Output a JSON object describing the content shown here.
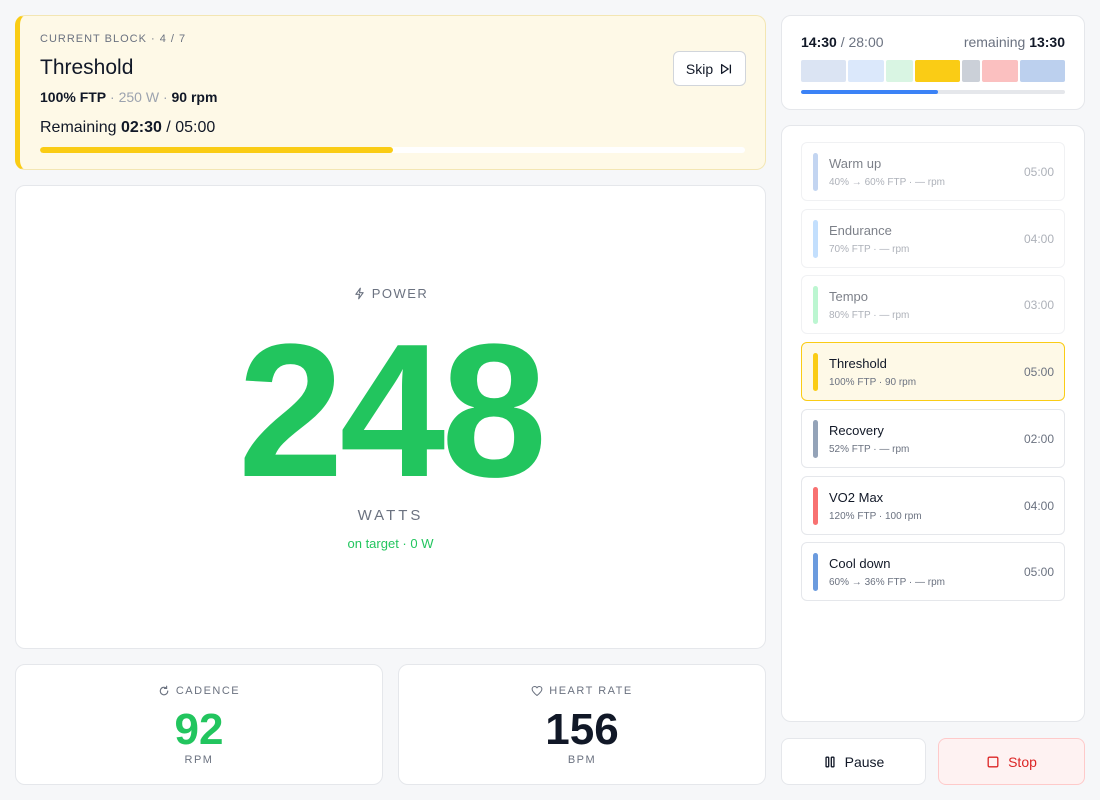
{
  "current_block": {
    "eyebrow": "CURRENT BLOCK · 4 / 7",
    "title": "Threshold",
    "ftp": "100% FTP",
    "watts": "250 W",
    "rpm": "90 rpm",
    "sep": " · ",
    "remaining_label": "Remaining",
    "remaining": "02:30",
    "duration": "05:00",
    "progress": 0.5,
    "skip_label": "Skip",
    "accent_color": "#facc15"
  },
  "power": {
    "label": "POWER",
    "value": "248",
    "unit": "WATTS",
    "target_status": "on target · 0 W",
    "color": "#22c55e"
  },
  "cadence": {
    "label": "CADENCE",
    "value": "92",
    "unit": "RPM",
    "color": "#22c55e"
  },
  "heart_rate": {
    "label": "HEART RATE",
    "value": "156",
    "unit": "BPM",
    "color": "#111827"
  },
  "timeline": {
    "elapsed": "14:30",
    "total": "28:00",
    "remaining_label": "remaining",
    "remaining": "13:30",
    "progress": 0.518,
    "segments": [
      {
        "duration": 5,
        "color": "#dbe4f3"
      },
      {
        "duration": 4,
        "color": "#dbe8fb"
      },
      {
        "duration": 3,
        "color": "#d9f5e3"
      },
      {
        "duration": 5,
        "color": "#facc15"
      },
      {
        "duration": 2,
        "color": "#cbd0d8"
      },
      {
        "duration": 4,
        "color": "#fbc0c0"
      },
      {
        "duration": 5,
        "color": "#bcd0ee"
      }
    ]
  },
  "blocks": [
    {
      "name": "Warm up",
      "sub": "40% → 60% FTP · — rpm",
      "time": "05:00",
      "color": "#93b4e6",
      "state": "done"
    },
    {
      "name": "Endurance",
      "sub": "70% FTP · — rpm",
      "time": "04:00",
      "color": "#93c5fd",
      "state": "done"
    },
    {
      "name": "Tempo",
      "sub": "80% FTP · — rpm",
      "time": "03:00",
      "color": "#86efac",
      "state": "done"
    },
    {
      "name": "Threshold",
      "sub": "100% FTP · 90 rpm",
      "time": "05:00",
      "color": "#facc15",
      "state": "active"
    },
    {
      "name": "Recovery",
      "sub": "52% FTP · — rpm",
      "time": "02:00",
      "color": "#94a3b8",
      "state": "upcoming"
    },
    {
      "name": "VO2 Max",
      "sub": "120% FTP · 100 rpm",
      "time": "04:00",
      "color": "#f87171",
      "state": "upcoming"
    },
    {
      "name": "Cool down",
      "sub": "60% → 36% FTP · — rpm",
      "time": "05:00",
      "color": "#6b9bde",
      "state": "upcoming"
    }
  ],
  "controls": {
    "pause_label": "Pause",
    "stop_label": "Stop"
  }
}
